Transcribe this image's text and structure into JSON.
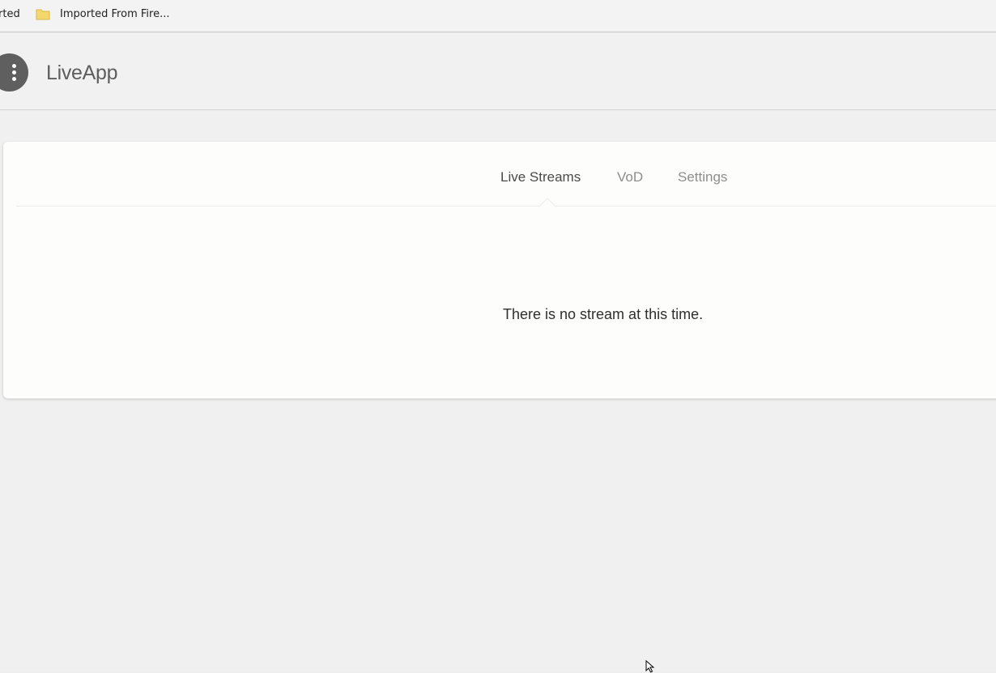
{
  "bookmarks": {
    "partial_item": "rted",
    "folder_item": "Imported From Fire..."
  },
  "header": {
    "title": "LiveApp",
    "menu_icon": "more-vert-icon"
  },
  "tabs": [
    {
      "label": "Live Streams",
      "active": true
    },
    {
      "label": "VoD",
      "active": false
    },
    {
      "label": "Settings",
      "active": false
    }
  ],
  "content": {
    "empty_message": "There is no stream at this time."
  },
  "colors": {
    "background": "#eeeeee",
    "card": "#fdfdfc",
    "menu_button": "#5f5f5f",
    "active_tab": "#4a4a4a",
    "inactive_tab": "#8e8e8e",
    "folder": "#f4d86b"
  }
}
